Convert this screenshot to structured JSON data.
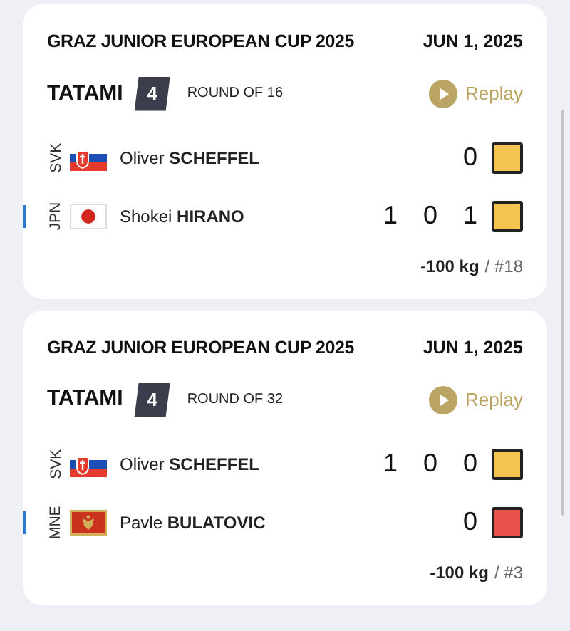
{
  "matches": [
    {
      "event": "GRAZ JUNIOR EUROPEAN CUP 2025",
      "date": "JUN 1, 2025",
      "tatami_label": "TATAMI",
      "tatami": "4",
      "round": "ROUND OF 16",
      "replay": "Replay",
      "players": [
        {
          "country": "SVK",
          "flag": {
            "kind": "slovakia"
          },
          "name": "Oliver **SCHEFFEL**",
          "scores": [
            "0"
          ],
          "blue_side": false,
          "color": "#f4c350"
        },
        {
          "country": "JPN",
          "flag": {
            "kind": "japan"
          },
          "name": "Shokei **HIRANO**",
          "scores": [
            "1",
            "0",
            "1"
          ],
          "blue_side": true,
          "color": "#f4c350"
        }
      ],
      "weight": "-100 kg",
      "bracket": "/ #18"
    },
    {
      "event": "GRAZ JUNIOR EUROPEAN CUP 2025",
      "date": "JUN 1, 2025",
      "tatami_label": "TATAMI",
      "tatami": "4",
      "round": "ROUND OF 32",
      "replay": "Replay",
      "players": [
        {
          "country": "SVK",
          "flag": {
            "kind": "slovakia"
          },
          "name": "Oliver **SCHEFFEL**",
          "scores": [
            "1",
            "0",
            "0"
          ],
          "blue_side": false,
          "color": "#f4c350"
        },
        {
          "country": "MNE",
          "flag": {
            "kind": "montenegro"
          },
          "name": "Pavle **BULATOVIC**",
          "scores": [
            "0"
          ],
          "blue_side": true,
          "color": "#e8524a"
        }
      ],
      "weight": "-100 kg",
      "bracket": "/ #3"
    }
  ]
}
